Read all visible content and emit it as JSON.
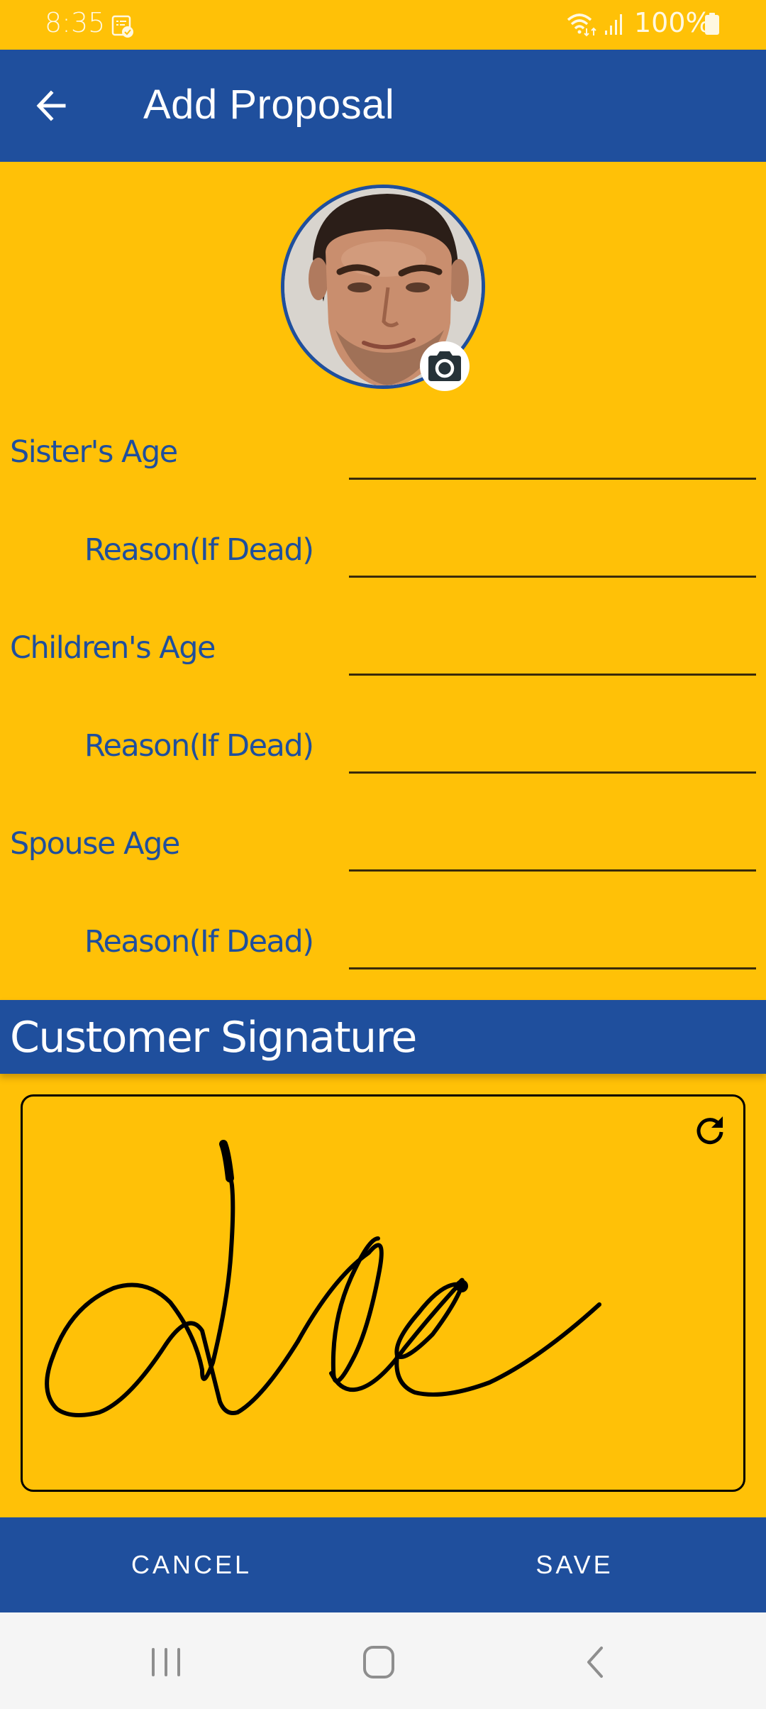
{
  "status_bar": {
    "time": "8:35",
    "battery": "100%",
    "icons": [
      "note-check-icon",
      "wifi-icon",
      "signal-icon",
      "battery-icon"
    ]
  },
  "app_bar": {
    "title": "Add Proposal",
    "back_icon": "arrow-left-icon"
  },
  "avatar": {
    "camera_icon": "camera-icon"
  },
  "form": {
    "fields": [
      {
        "label": "Sister's Age",
        "value": "",
        "type": "primary"
      },
      {
        "label": "Reason(If Dead)",
        "value": "",
        "type": "sub"
      },
      {
        "label": "Children's Age",
        "value": "",
        "type": "primary"
      },
      {
        "label": "Reason(If Dead)",
        "value": "",
        "type": "sub"
      },
      {
        "label": "Spouse Age",
        "value": "",
        "type": "primary"
      },
      {
        "label": "Reason(If Dead)",
        "value": "",
        "type": "sub"
      }
    ]
  },
  "signature": {
    "title": "Customer Signature",
    "refresh_icon": "refresh-icon"
  },
  "actions": {
    "cancel_label": "CANCEL",
    "save_label": "SAVE"
  },
  "nav_bar": {
    "icons": [
      "recent-apps-icon",
      "home-icon",
      "back-icon"
    ]
  },
  "colors": {
    "background": "#FFC107",
    "primary": "#1F4F9D",
    "text_on_primary": "#FFFFFF"
  }
}
